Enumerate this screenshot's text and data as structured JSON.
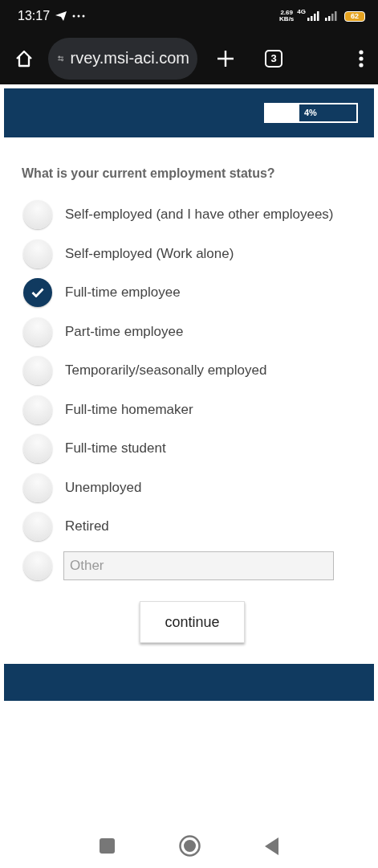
{
  "status_bar": {
    "time": "13:17",
    "speed": "2.69",
    "speed_unit": "KB/s",
    "network": "4G",
    "battery": "62"
  },
  "browser": {
    "url": "rvey.msi-aci.com",
    "tab_count": "3"
  },
  "progress": {
    "level": 0.37,
    "label": "4%"
  },
  "question": "What is your current employment status?",
  "options": [
    {
      "kind": "radio",
      "label": "Self-employed (and I have other employees)",
      "selected": false
    },
    {
      "kind": "radio",
      "label": "Self-employed (Work alone)",
      "selected": false
    },
    {
      "kind": "radio",
      "label": "Full-time employee",
      "selected": true
    },
    {
      "kind": "radio",
      "label": "Part-time employee",
      "selected": false
    },
    {
      "kind": "radio",
      "label": "Temporarily/seasonally employed",
      "selected": false
    },
    {
      "kind": "radio",
      "label": "Full-time homemaker",
      "selected": false
    },
    {
      "kind": "radio",
      "label": "Full-time student",
      "selected": false
    },
    {
      "kind": "radio",
      "label": "Unemployed",
      "selected": false
    },
    {
      "kind": "radio",
      "label": "Retired",
      "selected": false
    },
    {
      "kind": "other",
      "placeholder": "Other",
      "selected": false
    }
  ],
  "continue_button": "continue"
}
